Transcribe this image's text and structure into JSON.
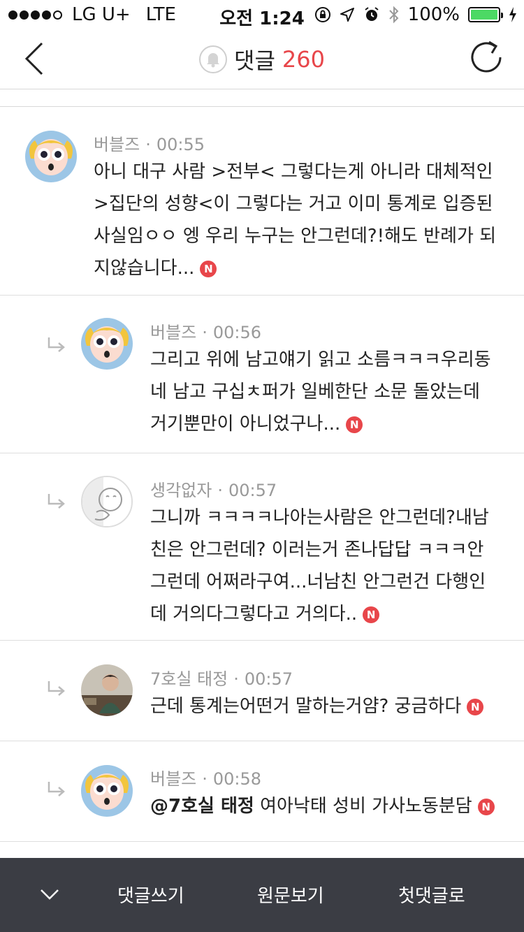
{
  "status_bar": {
    "carrier": "LG U+",
    "network": "LTE",
    "time": "오전 1:24",
    "battery": "100%"
  },
  "header": {
    "title": "댓글",
    "count": "260"
  },
  "comments": [
    {
      "author": "버블즈",
      "time": "00:55",
      "text": "아니 대구 사람 >전부< 그렇다는게 아니라 대체적인 >집단의 성향<이 그렇다는 거고 이미 통계로 입증된 사실임ㅇㅇ 엥 우리 누구는 안그런데?!해도 반례가 되지않습니다...",
      "badge": "N"
    },
    {
      "author": "버블즈",
      "time": "00:56",
      "text": "그리고 위에 남고얘기 읽고 소름ㅋㅋㅋ우리동네 남고 구십ㅊ퍼가 일베한단 소문 돌았는데 거기뿐만이 아니었구나...",
      "badge": "N"
    },
    {
      "author": "생각없자",
      "time": "00:57",
      "text": "그니까 ㅋㅋㅋㅋ나아는사람은 안그런데?내남친은 안그런데? 이러는거 존나답답 ㅋㅋㅋ안그런데 어쩌라구여...너남친 안그런건 다행인데 거의다그렇다고 거의다..",
      "badge": "N"
    },
    {
      "author": "7호실 태정",
      "time": "00:57",
      "text": "근데 통계는어떤거 말하는거얌? 궁금하다",
      "badge": "N"
    },
    {
      "author": "버블즈",
      "time": "00:58",
      "mention": "@7호실 태정",
      "text": "여아낙태 성비 가사노동분담",
      "badge": "N"
    }
  ],
  "bottom_bar": {
    "write": "댓글쓰기",
    "original": "원문보기",
    "first": "첫댓글로"
  }
}
